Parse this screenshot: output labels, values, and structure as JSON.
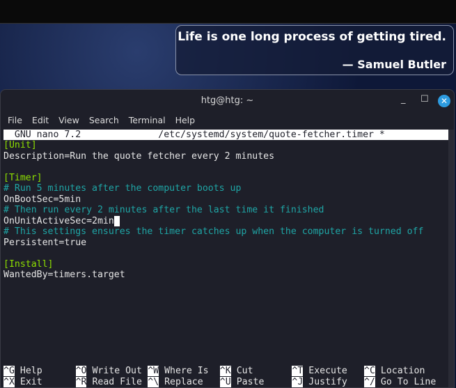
{
  "quote": {
    "text": "Life is one long process of getting tired.",
    "author": "— Samuel Butler"
  },
  "window": {
    "title": "htg@htg: ~",
    "minimize": "_",
    "maximize": "☐",
    "close": "✕"
  },
  "menu": [
    "File",
    "Edit",
    "View",
    "Search",
    "Terminal",
    "Help"
  ],
  "nano": {
    "header": "  GNU nano 7.2              /etc/systemd/system/quote-fetcher.timer *"
  },
  "lines": [
    {
      "t": "sec",
      "v": "[Unit]"
    },
    {
      "t": "txt",
      "v": "Description=Run the quote fetcher every 2 minutes"
    },
    {
      "t": "txt",
      "v": ""
    },
    {
      "t": "sec",
      "v": "[Timer]"
    },
    {
      "t": "cmt",
      "v": "# Run 5 minutes after the computer boots up"
    },
    {
      "t": "txt",
      "v": "OnBootSec=5min"
    },
    {
      "t": "cmt",
      "v": "# Then run every 2 minutes after the last time it finished"
    },
    {
      "t": "cur",
      "v": "OnUnitActiveSec=2min"
    },
    {
      "t": "cmt",
      "v": "# This settings ensures the timer catches up when the computer is turned off"
    },
    {
      "t": "txt",
      "v": "Persistent=true"
    },
    {
      "t": "txt",
      "v": ""
    },
    {
      "t": "sec",
      "v": "[Install]"
    },
    {
      "t": "txt",
      "v": "WantedBy=timers.target"
    }
  ],
  "shortcuts": [
    [
      {
        "k": "^G",
        "l": "Help"
      },
      {
        "k": "^O",
        "l": "Write Out"
      },
      {
        "k": "^W",
        "l": "Where Is"
      },
      {
        "k": "^K",
        "l": "Cut"
      },
      {
        "k": "^T",
        "l": "Execute"
      },
      {
        "k": "^C",
        "l": "Location"
      }
    ],
    [
      {
        "k": "^X",
        "l": "Exit"
      },
      {
        "k": "^R",
        "l": "Read File"
      },
      {
        "k": "^\\",
        "l": "Replace"
      },
      {
        "k": "^U",
        "l": "Paste"
      },
      {
        "k": "^J",
        "l": "Justify"
      },
      {
        "k": "^/",
        "l": "Go To Line"
      }
    ]
  ]
}
